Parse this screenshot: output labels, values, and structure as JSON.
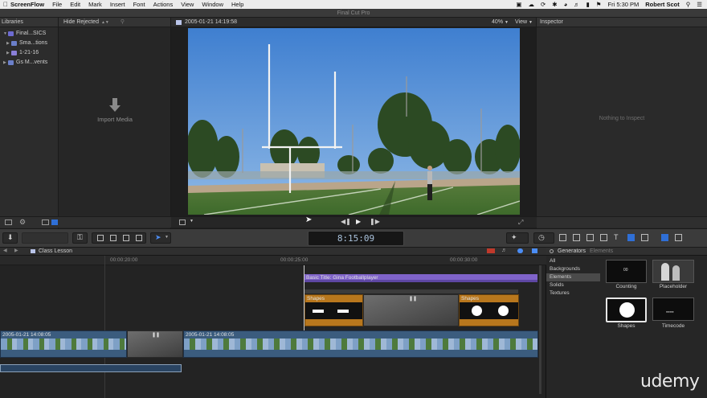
{
  "menubar": {
    "app": "ScreenFlow",
    "items": [
      "File",
      "Edit",
      "Mark",
      "Insert",
      "Font",
      "Actions",
      "View",
      "Window",
      "Help"
    ],
    "clock": "Fri 5:30 PM",
    "user": "Robert Scot"
  },
  "window": {
    "title": "Final Cut Pro"
  },
  "libraries": {
    "header": "Libraries",
    "items": [
      {
        "label": "Final...SICS",
        "color": "#6d6bd1"
      },
      {
        "label": "Sma...tions",
        "color": "#6b7fc9"
      },
      {
        "label": "1-21-16",
        "color": "#8a7fd8"
      },
      {
        "label": "Gs M...vents",
        "color": "#6b7fc9"
      }
    ]
  },
  "browser": {
    "filter": "Hide Rejected",
    "empty_label": "Import Media"
  },
  "viewer": {
    "clip_title": "2005-01-21 14:19:58",
    "zoom": "40%",
    "view_label": "View"
  },
  "inspector": {
    "header": "Inspector",
    "empty_label": "Nothing to Inspect"
  },
  "toolbar": {
    "timecode": "8:15:09"
  },
  "timeline": {
    "project": "Class Lesson",
    "ruler": [
      "00:00:20:00",
      "00:00:25:00",
      "00:00:30:00"
    ],
    "title_clip": "Basic Title: Gina Footballplayer",
    "shape_clip_1": "Shapes",
    "shape_clip_2": "Shapes",
    "video_clip_1": "2005-01-21 14:08:05",
    "video_clip_2": "2005-01-21 14:08:05"
  },
  "generators": {
    "tab_generators": "Generators",
    "tab_elements": "Elements",
    "categories": [
      "All",
      "Backgrounds",
      "Elements",
      "Solids",
      "Textures"
    ],
    "selected_category": "Elements",
    "thumbs": [
      "Counting",
      "Placeholder",
      "Shapes",
      "Timecode"
    ]
  },
  "watermark": "udemy",
  "colors": {
    "title_clip": "#7f63c9",
    "shape_clip": "#b8771d",
    "video_clip": "#3b5c7e",
    "selection": "#2f6fd6"
  }
}
